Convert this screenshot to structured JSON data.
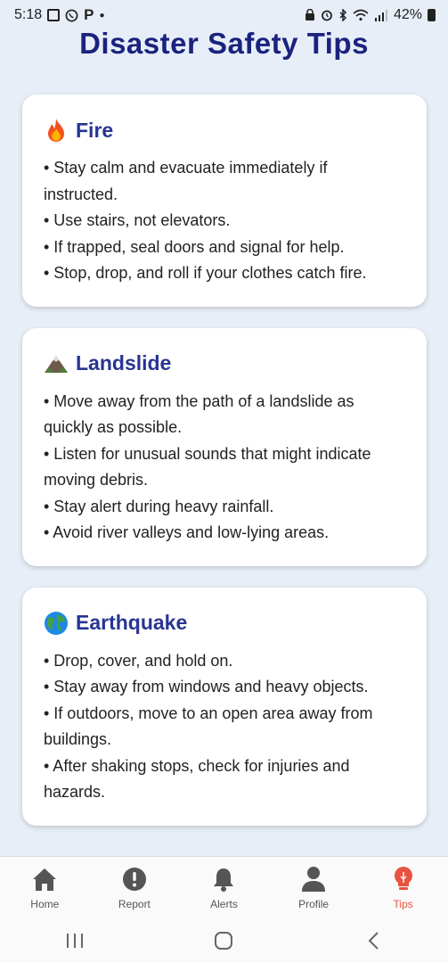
{
  "status_bar": {
    "time": "5:18",
    "battery": "42%"
  },
  "header": {
    "title": "Disaster Safety Tips"
  },
  "cards": [
    {
      "icon": "fire-icon",
      "title": "Fire",
      "lines": [
        "• Stay calm and evacuate immediately if",
        "instructed.",
        "• Use stairs, not elevators.",
        "• If trapped, seal doors and signal for help.",
        "• Stop, drop, and roll if your clothes catch fire."
      ]
    },
    {
      "icon": "mountain-icon",
      "title": "Landslide",
      "lines": [
        "• Move away from the path of a landslide as",
        "quickly as possible.",
        "• Listen for unusual sounds that might indicate",
        "moving debris.",
        "• Stay alert during heavy rainfall.",
        "• Avoid river valleys and low-lying areas."
      ]
    },
    {
      "icon": "globe-icon",
      "title": "Earthquake",
      "lines": [
        "• Drop, cover, and hold on.",
        "• Stay away from windows and heavy objects.",
        "• If outdoors, move to an open area away from",
        "buildings.",
        "• After shaking stops, check for injuries and",
        "hazards."
      ]
    }
  ],
  "bottom_nav": {
    "items": [
      {
        "label": "Home",
        "icon": "home-icon"
      },
      {
        "label": "Report",
        "icon": "alert-circle-icon"
      },
      {
        "label": "Alerts",
        "icon": "bell-icon"
      },
      {
        "label": "Profile",
        "icon": "person-icon"
      },
      {
        "label": "Tips",
        "icon": "lightbulb-icon"
      }
    ],
    "active": "Tips",
    "active_color": "#e8533f",
    "inactive_color": "#555555"
  },
  "colors": {
    "background": "#e8eef8",
    "title": "#1a237e",
    "card_title": "#283593"
  }
}
